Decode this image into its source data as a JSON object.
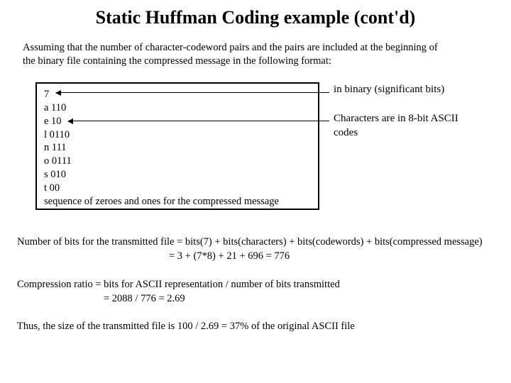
{
  "title": "Static Huffman Coding example (cont'd)",
  "intro_line1": "Assuming that the number of character-codeword pairs and the pairs are included at the beginning of",
  "intro_line2": " the binary file containing the compressed message in the following format:",
  "filebox": {
    "count": "7",
    "rows": [
      "a 110",
      "e 10",
      "l 0110",
      "n 111",
      "o 0111",
      "s 010",
      "t 00"
    ],
    "footer": "sequence of zeroes and ones for the compressed message"
  },
  "annot1": "in binary (significant bits)",
  "annot2": "Characters are in 8-bit ASCII codes",
  "calc1_line1": "Number of bits for the transmitted file = bits(7) + bits(characters) + bits(codewords) + bits(compressed message)",
  "calc1_line2": "= 3 +  (7*8) + 21 + 696 = 776",
  "calc2_line1": "Compression ratio = bits for ASCII representation / number of bits transmitted",
  "calc2_line2": "=   2088 / 776 = 2.69",
  "calc3": "Thus, the size of the transmitted file is 100 / 2.69 = 37% of the original ASCII file"
}
